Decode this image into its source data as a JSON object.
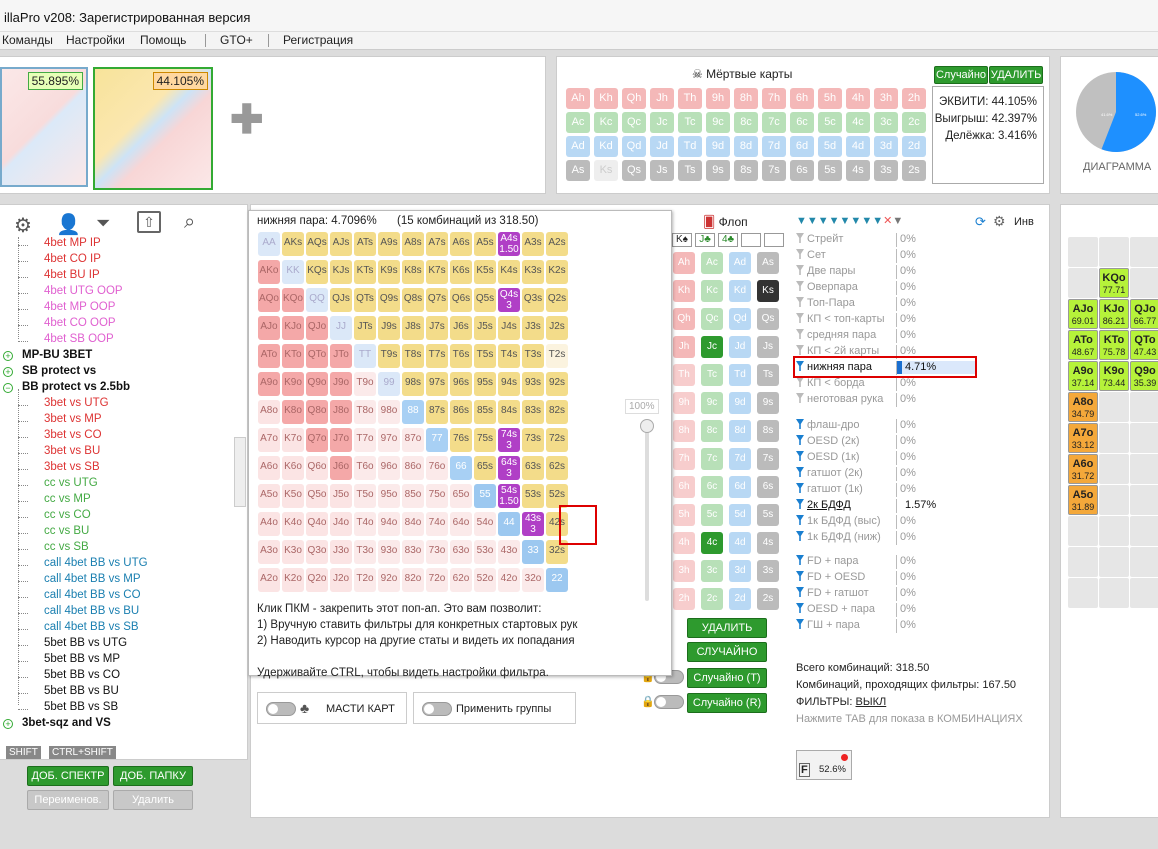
{
  "window": {
    "title": "illaPro v208: Зарегистрированная версия"
  },
  "menu": [
    "Команды",
    "Настройки",
    "Помощь",
    "GTO+",
    "Регистрация"
  ],
  "thumbs": {
    "left_pct": "55.895%",
    "right_pct": "44.105%"
  },
  "dead_cards": {
    "title": "Мёртвые карты",
    "random_label": "Случайно",
    "delete_label": "УДАЛИТЬ",
    "rows": [
      [
        "Ah",
        "Kh",
        "Qh",
        "Jh",
        "Th",
        "9h",
        "8h",
        "7h",
        "6h",
        "5h",
        "4h",
        "3h",
        "2h"
      ],
      [
        "Ac",
        "Kc",
        "Qc",
        "Jc",
        "Tc",
        "9c",
        "8c",
        "7c",
        "6c",
        "5c",
        "4c",
        "3c",
        "2c"
      ],
      [
        "Ad",
        "Kd",
        "Qd",
        "Jd",
        "Td",
        "9d",
        "8d",
        "7d",
        "6d",
        "5d",
        "4d",
        "3d",
        "2d"
      ],
      [
        "As",
        "Ks",
        "Qs",
        "Js",
        "Ts",
        "9s",
        "8s",
        "7s",
        "6s",
        "5s",
        "4s",
        "3s",
        "2s"
      ]
    ]
  },
  "equity": {
    "equity": "ЭКВИТИ: 44.105%",
    "win": "Выигрыш: 42.397%",
    "split": "Делёжка: 3.416%"
  },
  "pie": {
    "label": "ДИАГРАММА",
    "value_pct": 55.895,
    "inner_left": "41.6%",
    "inner_right": "52.6%",
    "colors": {
      "blue": "#1e90ff",
      "gray": "#c0c0c0"
    }
  },
  "tree": {
    "items": [
      {
        "t": "4bet MP IP",
        "c": "#d33"
      },
      {
        "t": "4bet CO IP",
        "c": "#d33"
      },
      {
        "t": "4bet BU IP",
        "c": "#d33"
      },
      {
        "t": "4bet UTG OOP",
        "c": "#e060d0"
      },
      {
        "t": "4bet MP OOP",
        "c": "#e060d0"
      },
      {
        "t": "4bet CO OOP",
        "c": "#e060d0"
      },
      {
        "t": "4bet SB OOP",
        "c": "#e060d0"
      },
      {
        "t": "MP-BU 3BET",
        "c": "#111",
        "b": true,
        "top": true
      },
      {
        "t": "SB protect vs",
        "c": "#111",
        "b": true,
        "top": true
      },
      {
        "t": "BB protect vs 2.5bb",
        "c": "#111",
        "b": true,
        "top": true,
        "open": true
      },
      {
        "t": "3bet vs UTG",
        "c": "#d33"
      },
      {
        "t": "3bet vs MP",
        "c": "#d33"
      },
      {
        "t": "3bet vs CO",
        "c": "#d33"
      },
      {
        "t": "3bet vs BU",
        "c": "#d33"
      },
      {
        "t": "3bet vs SB",
        "c": "#d33"
      },
      {
        "t": "cc vs UTG",
        "c": "#4a4"
      },
      {
        "t": "cc vs MP",
        "c": "#4a4"
      },
      {
        "t": "cc vs CO",
        "c": "#4a4"
      },
      {
        "t": "cc vs BU",
        "c": "#4a4"
      },
      {
        "t": "cc vs SB",
        "c": "#4a4"
      },
      {
        "t": "call 4bet BB vs UTG",
        "c": "#1a7fb0"
      },
      {
        "t": "call 4bet BB vs MP",
        "c": "#1a7fb0"
      },
      {
        "t": "call 4bet BB vs CO",
        "c": "#1a7fb0"
      },
      {
        "t": "call 4bet BB vs BU",
        "c": "#1a7fb0"
      },
      {
        "t": "call 4bet BB vs SB",
        "c": "#1a7fb0"
      },
      {
        "t": "5bet BB vs UTG",
        "c": "#111"
      },
      {
        "t": "5bet BB vs MP",
        "c": "#111"
      },
      {
        "t": "5bet BB vs CO",
        "c": "#111"
      },
      {
        "t": "5bet BB vs BU",
        "c": "#111"
      },
      {
        "t": "5bet BB vs SB",
        "c": "#111"
      },
      {
        "t": "3bet-sqz and VS",
        "c": "#111",
        "b": true,
        "top": true
      }
    ]
  },
  "tree_buttons": {
    "shift": "SHIFT",
    "ctrl_shift": "CTRL+SHIFT",
    "add_spectrum": "ДОБ. СПЕКТР",
    "add_folder": "ДОБ. ПАПКУ",
    "rename": "Переименов.",
    "delete": "Удалить"
  },
  "popup": {
    "header": "нижняя пара: 4.7096%",
    "header2": "(15 комбинаций из 318.50)",
    "slider_pct": "100%",
    "help": [
      "Клик ПКМ - закрепить этот поп-ап. Это вам позволит:",
      "1) Вручную ставить фильтры для конкретных стартовых рук",
      "2) Наводить курсор на другие статы и видеть их попадания",
      "",
      "Удерживайте CTRL, чтобы видеть настройки фильтра."
    ],
    "ranks": [
      "A",
      "K",
      "Q",
      "J",
      "T",
      "9",
      "8",
      "7",
      "6",
      "5",
      "4",
      "3",
      "2"
    ],
    "highlight": {
      "A4s": "3",
      "Q4s": "3",
      "74s": "3",
      "64s": "3",
      "54s": "1.50",
      "43s": "3",
      "A4s_top": "1.50"
    }
  },
  "flop": {
    "title": "Флоп",
    "slots": [
      "K♠",
      "J♣",
      "4♣"
    ]
  },
  "board_buttons": {
    "delete": "УДАЛИТЬ",
    "random": "СЛУЧАЙНО",
    "random_t": "Случайно (T)",
    "random_r": "Случайно (R)"
  },
  "suits_toggle": "МАСТИ КАРТ",
  "groups_toggle": "Применить группы",
  "filters": {
    "inv": "Инв",
    "groupA": [
      {
        "n": "Стрейт",
        "p": "0%"
      },
      {
        "n": "Сет",
        "p": "0%"
      },
      {
        "n": "Две пары",
        "p": "0%"
      },
      {
        "n": "Оверпара",
        "p": "0%"
      },
      {
        "n": "Топ-Пара",
        "p": "0%"
      },
      {
        "n": "КП < топ-карты",
        "p": "0%"
      },
      {
        "n": "средняя пара",
        "p": "0%"
      },
      {
        "n": "КП < 2й карты",
        "p": "0%"
      },
      {
        "n": "нижняя пара",
        "p": "4.71%",
        "active": true
      },
      {
        "n": "КП < борда",
        "p": "0%"
      },
      {
        "n": "неготовая рука",
        "p": "0%"
      }
    ],
    "groupB": [
      {
        "n": "флаш-дро",
        "p": "0%"
      },
      {
        "n": "OESD (2к)",
        "p": "0%"
      },
      {
        "n": "OESD (1к)",
        "p": "0%"
      },
      {
        "n": "гатшот (2к)",
        "p": "0%"
      },
      {
        "n": "гатшот (1к)",
        "p": "0%"
      },
      {
        "n": "2к БДФД",
        "p": "1.57%",
        "active": true
      },
      {
        "n": "1к БДФД (выс)",
        "p": "0%"
      },
      {
        "n": "1к БДФД (ниж)",
        "p": "0%"
      }
    ],
    "groupC": [
      {
        "n": "FD + пара",
        "p": "0%"
      },
      {
        "n": "FD + OESD",
        "p": "0%"
      },
      {
        "n": "FD + гатшот",
        "p": "0%"
      },
      {
        "n": "OESD + пара",
        "p": "0%"
      },
      {
        "n": "ГШ + пара",
        "p": "0%"
      }
    ],
    "total": "Всего комбинаций: 318.50",
    "passing": "Комбинаций, проходящих фильтры: 167.50",
    "filters_label": "ФИЛЬТРЫ:",
    "filters_state": "ВЫКЛ",
    "tab_hint": "Нажмите TAB для показа в КОМБИНАЦИЯХ",
    "badge": "52.6%"
  },
  "range_cells": [
    {
      "n": "KQo",
      "v": "77.71"
    },
    {
      "n": "AJo",
      "v": "69.01"
    },
    {
      "n": "KJo",
      "v": "86.21"
    },
    {
      "n": "QJo",
      "v": "66.77"
    },
    {
      "n": "ATo",
      "v": "48.67"
    },
    {
      "n": "KTo",
      "v": "75.78"
    },
    {
      "n": "QTo",
      "v": "47.43"
    },
    {
      "n": "A9o",
      "v": "37.14"
    },
    {
      "n": "K9o",
      "v": "73.44"
    },
    {
      "n": "Q9o",
      "v": "35.39"
    },
    {
      "n": "A8o",
      "v": "34.79"
    },
    {
      "n": "A7o",
      "v": "33.12"
    },
    {
      "n": "A6o",
      "v": "31.72"
    },
    {
      "n": "A5o",
      "v": "31.89"
    }
  ]
}
